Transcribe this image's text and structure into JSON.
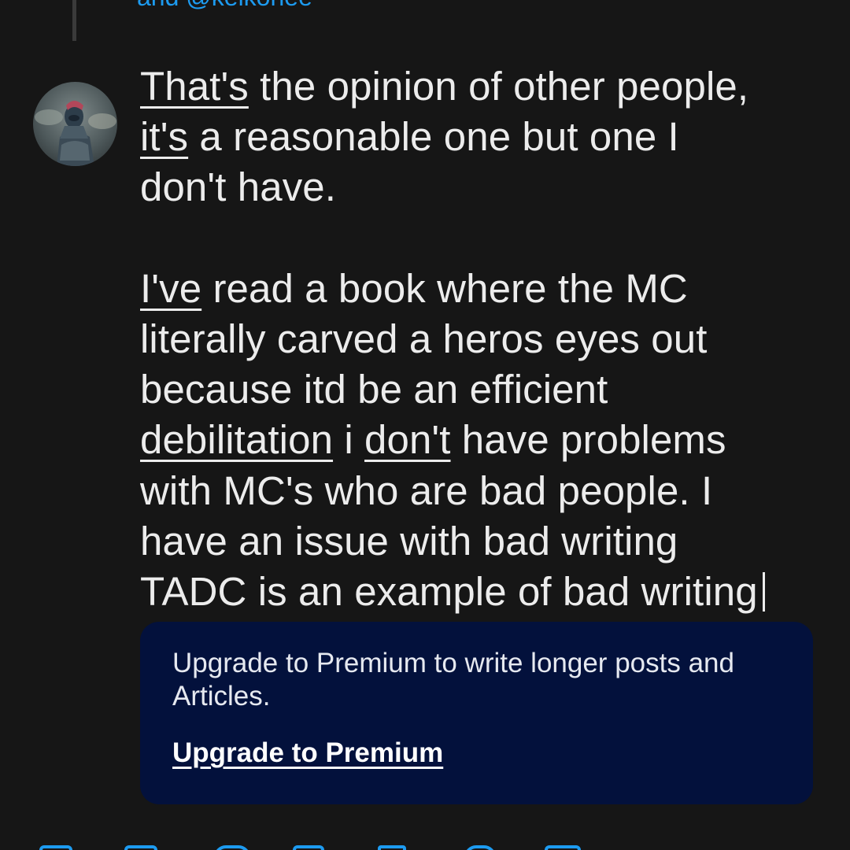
{
  "thread": {
    "replying_to": "and @keikonee"
  },
  "compose": {
    "lines": [
      [
        {
          "t": "That's",
          "u": true
        },
        {
          "t": " the opinion of other people,",
          "u": false
        }
      ],
      [
        {
          "t": "it's",
          "u": true
        },
        {
          "t": " a reasonable one but one I",
          "u": false
        }
      ],
      [
        {
          "t": "don't have.",
          "u": false
        }
      ],
      [],
      [
        {
          "t": "I've",
          "u": true
        },
        {
          "t": " read a book where the MC",
          "u": false
        }
      ],
      [
        {
          "t": "literally carved a heros eyes out",
          "u": false
        }
      ],
      [
        {
          "t": "because itd be an efficient",
          "u": false
        }
      ],
      [
        {
          "t": "debilitation",
          "u": true
        },
        {
          "t": " i ",
          "u": false
        },
        {
          "t": "don't",
          "u": true
        },
        {
          "t": " have problems",
          "u": false
        }
      ],
      [
        {
          "t": "with MC's who are bad people. I",
          "u": false
        }
      ],
      [
        {
          "t": "have an issue with bad writing",
          "u": false
        }
      ],
      [
        {
          "t": "TADC is an example of bad writing",
          "u": false
        }
      ]
    ]
  },
  "premium_card": {
    "message": "Upgrade to Premium to write longer posts and Articles.",
    "link_label": "Upgrade to Premium"
  },
  "toolbar": {
    "icons": [
      "image-icon",
      "gif-icon",
      "grok-icon",
      "poll-icon",
      "emoji-icon",
      "schedule-icon",
      "location-icon",
      "more-icon"
    ]
  },
  "colors": {
    "background": "#161616",
    "accent": "#1d9bf0",
    "card_background": "#03113c",
    "text": "#ececec"
  }
}
